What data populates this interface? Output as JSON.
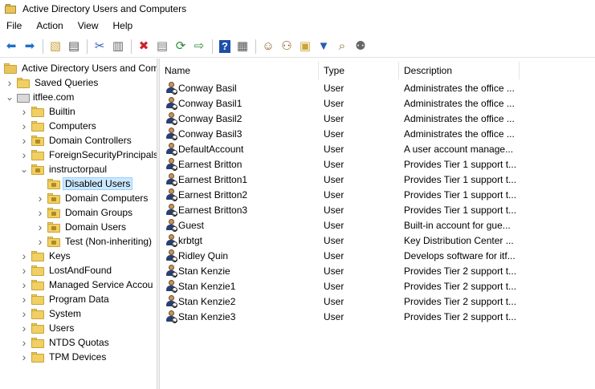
{
  "window": {
    "title": "Active Directory Users and Computers"
  },
  "menu": [
    "File",
    "Action",
    "View",
    "Help"
  ],
  "toolbar_icons": [
    "back-arrow-icon",
    "forward-arrow-icon",
    "sep",
    "up-folder-icon",
    "show-tree-icon",
    "sep",
    "cut-icon",
    "clipboard-icon",
    "sep",
    "delete-icon",
    "properties-icon",
    "refresh-icon",
    "export-list-icon",
    "sep",
    "help-icon",
    "action-pane-icon",
    "sep",
    "new-user-icon",
    "new-group-icon",
    "new-ou-icon",
    "filter-icon",
    "find-icon",
    "add-to-group-icon"
  ],
  "tree": [
    {
      "label": "Active Directory Users and Com",
      "level": 0,
      "twisty": "",
      "icon": "root",
      "name": "tree-root"
    },
    {
      "label": "Saved Queries",
      "level": 1,
      "twisty": "collapsed",
      "icon": "folder",
      "name": "tree-saved-queries"
    },
    {
      "label": "itflee.com",
      "level": 1,
      "twisty": "expanded",
      "icon": "domain",
      "name": "tree-domain"
    },
    {
      "label": "Builtin",
      "level": 2,
      "twisty": "collapsed",
      "icon": "folder",
      "name": "tree-builtin"
    },
    {
      "label": "Computers",
      "level": 2,
      "twisty": "collapsed",
      "icon": "folder",
      "name": "tree-computers"
    },
    {
      "label": "Domain Controllers",
      "level": 2,
      "twisty": "collapsed",
      "icon": "ou",
      "name": "tree-domain-controllers"
    },
    {
      "label": "ForeignSecurityPrincipals",
      "level": 2,
      "twisty": "collapsed",
      "icon": "folder",
      "name": "tree-foreign-security-principals"
    },
    {
      "label": "instructorpaul",
      "level": 2,
      "twisty": "expanded",
      "icon": "ou",
      "name": "tree-instructorpaul"
    },
    {
      "label": "Disabled Users",
      "level": 3,
      "twisty": "",
      "icon": "ou",
      "name": "tree-disabled-users",
      "selected": true
    },
    {
      "label": "Domain Computers",
      "level": 3,
      "twisty": "collapsed",
      "icon": "ou",
      "name": "tree-domain-computers"
    },
    {
      "label": "Domain Groups",
      "level": 3,
      "twisty": "collapsed",
      "icon": "ou",
      "name": "tree-domain-groups"
    },
    {
      "label": "Domain Users",
      "level": 3,
      "twisty": "collapsed",
      "icon": "ou",
      "name": "tree-domain-users"
    },
    {
      "label": "Test (Non-inheriting)",
      "level": 3,
      "twisty": "collapsed",
      "icon": "ou",
      "name": "tree-test-non-inheriting"
    },
    {
      "label": "Keys",
      "level": 2,
      "twisty": "collapsed",
      "icon": "folder",
      "name": "tree-keys"
    },
    {
      "label": "LostAndFound",
      "level": 2,
      "twisty": "collapsed",
      "icon": "folder",
      "name": "tree-lost-and-found"
    },
    {
      "label": "Managed Service Accou",
      "level": 2,
      "twisty": "collapsed",
      "icon": "folder",
      "name": "tree-managed-service-accounts"
    },
    {
      "label": "Program Data",
      "level": 2,
      "twisty": "collapsed",
      "icon": "folder",
      "name": "tree-program-data"
    },
    {
      "label": "System",
      "level": 2,
      "twisty": "collapsed",
      "icon": "folder",
      "name": "tree-system"
    },
    {
      "label": "Users",
      "level": 2,
      "twisty": "collapsed",
      "icon": "folder",
      "name": "tree-users"
    },
    {
      "label": "NTDS Quotas",
      "level": 2,
      "twisty": "collapsed",
      "icon": "folder",
      "name": "tree-ntds-quotas"
    },
    {
      "label": "TPM Devices",
      "level": 2,
      "twisty": "collapsed",
      "icon": "folder",
      "name": "tree-tpm-devices"
    }
  ],
  "columns": [
    {
      "label": "Name",
      "name": "column-name"
    },
    {
      "label": "Type",
      "name": "column-type"
    },
    {
      "label": "Description",
      "name": "column-description"
    }
  ],
  "rows": [
    {
      "name": "Conway Basil",
      "type": "User",
      "description": "Administrates the office ..."
    },
    {
      "name": "Conway Basil1",
      "type": "User",
      "description": "Administrates the office ..."
    },
    {
      "name": "Conway Basil2",
      "type": "User",
      "description": "Administrates the office ..."
    },
    {
      "name": "Conway Basil3",
      "type": "User",
      "description": "Administrates the office ..."
    },
    {
      "name": "DefaultAccount",
      "type": "User",
      "description": "A user account manage..."
    },
    {
      "name": "Earnest Britton",
      "type": "User",
      "description": "Provides Tier 1 support t..."
    },
    {
      "name": "Earnest Britton1",
      "type": "User",
      "description": "Provides Tier 1 support t..."
    },
    {
      "name": "Earnest Britton2",
      "type": "User",
      "description": "Provides Tier 1 support t..."
    },
    {
      "name": "Earnest Britton3",
      "type": "User",
      "description": "Provides Tier 1 support t..."
    },
    {
      "name": "Guest",
      "type": "User",
      "description": "Built-in account for gue..."
    },
    {
      "name": "krbtgt",
      "type": "User",
      "description": "Key Distribution Center ..."
    },
    {
      "name": "Ridley Quin",
      "type": "User",
      "description": "Develops software for itf..."
    },
    {
      "name": "Stan Kenzie",
      "type": "User",
      "description": "Provides Tier 2 support t..."
    },
    {
      "name": "Stan Kenzie1",
      "type": "User",
      "description": "Provides Tier 2 support t..."
    },
    {
      "name": "Stan Kenzie2",
      "type": "User",
      "description": "Provides Tier 2 support t..."
    },
    {
      "name": "Stan Kenzie3",
      "type": "User",
      "description": "Provides Tier 2 support t..."
    }
  ],
  "colors": {
    "selection": "#cce8ff",
    "selection_border": "#99d1ff",
    "folder": "#f0cf63"
  }
}
